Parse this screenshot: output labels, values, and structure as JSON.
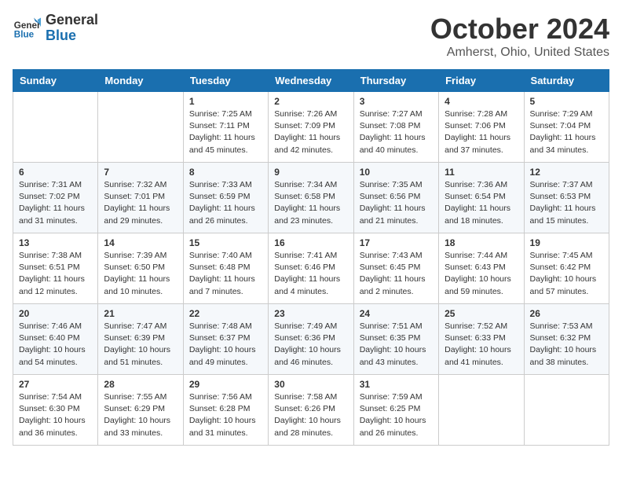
{
  "header": {
    "logo_general": "General",
    "logo_blue": "Blue",
    "month_title": "October 2024",
    "location": "Amherst, Ohio, United States"
  },
  "days_of_week": [
    "Sunday",
    "Monday",
    "Tuesday",
    "Wednesday",
    "Thursday",
    "Friday",
    "Saturday"
  ],
  "weeks": [
    [
      {
        "day": "",
        "info": ""
      },
      {
        "day": "",
        "info": ""
      },
      {
        "day": "1",
        "info": "Sunrise: 7:25 AM\nSunset: 7:11 PM\nDaylight: 11 hours and 45 minutes."
      },
      {
        "day": "2",
        "info": "Sunrise: 7:26 AM\nSunset: 7:09 PM\nDaylight: 11 hours and 42 minutes."
      },
      {
        "day": "3",
        "info": "Sunrise: 7:27 AM\nSunset: 7:08 PM\nDaylight: 11 hours and 40 minutes."
      },
      {
        "day": "4",
        "info": "Sunrise: 7:28 AM\nSunset: 7:06 PM\nDaylight: 11 hours and 37 minutes."
      },
      {
        "day": "5",
        "info": "Sunrise: 7:29 AM\nSunset: 7:04 PM\nDaylight: 11 hours and 34 minutes."
      }
    ],
    [
      {
        "day": "6",
        "info": "Sunrise: 7:31 AM\nSunset: 7:02 PM\nDaylight: 11 hours and 31 minutes."
      },
      {
        "day": "7",
        "info": "Sunrise: 7:32 AM\nSunset: 7:01 PM\nDaylight: 11 hours and 29 minutes."
      },
      {
        "day": "8",
        "info": "Sunrise: 7:33 AM\nSunset: 6:59 PM\nDaylight: 11 hours and 26 minutes."
      },
      {
        "day": "9",
        "info": "Sunrise: 7:34 AM\nSunset: 6:58 PM\nDaylight: 11 hours and 23 minutes."
      },
      {
        "day": "10",
        "info": "Sunrise: 7:35 AM\nSunset: 6:56 PM\nDaylight: 11 hours and 21 minutes."
      },
      {
        "day": "11",
        "info": "Sunrise: 7:36 AM\nSunset: 6:54 PM\nDaylight: 11 hours and 18 minutes."
      },
      {
        "day": "12",
        "info": "Sunrise: 7:37 AM\nSunset: 6:53 PM\nDaylight: 11 hours and 15 minutes."
      }
    ],
    [
      {
        "day": "13",
        "info": "Sunrise: 7:38 AM\nSunset: 6:51 PM\nDaylight: 11 hours and 12 minutes."
      },
      {
        "day": "14",
        "info": "Sunrise: 7:39 AM\nSunset: 6:50 PM\nDaylight: 11 hours and 10 minutes."
      },
      {
        "day": "15",
        "info": "Sunrise: 7:40 AM\nSunset: 6:48 PM\nDaylight: 11 hours and 7 minutes."
      },
      {
        "day": "16",
        "info": "Sunrise: 7:41 AM\nSunset: 6:46 PM\nDaylight: 11 hours and 4 minutes."
      },
      {
        "day": "17",
        "info": "Sunrise: 7:43 AM\nSunset: 6:45 PM\nDaylight: 11 hours and 2 minutes."
      },
      {
        "day": "18",
        "info": "Sunrise: 7:44 AM\nSunset: 6:43 PM\nDaylight: 10 hours and 59 minutes."
      },
      {
        "day": "19",
        "info": "Sunrise: 7:45 AM\nSunset: 6:42 PM\nDaylight: 10 hours and 57 minutes."
      }
    ],
    [
      {
        "day": "20",
        "info": "Sunrise: 7:46 AM\nSunset: 6:40 PM\nDaylight: 10 hours and 54 minutes."
      },
      {
        "day": "21",
        "info": "Sunrise: 7:47 AM\nSunset: 6:39 PM\nDaylight: 10 hours and 51 minutes."
      },
      {
        "day": "22",
        "info": "Sunrise: 7:48 AM\nSunset: 6:37 PM\nDaylight: 10 hours and 49 minutes."
      },
      {
        "day": "23",
        "info": "Sunrise: 7:49 AM\nSunset: 6:36 PM\nDaylight: 10 hours and 46 minutes."
      },
      {
        "day": "24",
        "info": "Sunrise: 7:51 AM\nSunset: 6:35 PM\nDaylight: 10 hours and 43 minutes."
      },
      {
        "day": "25",
        "info": "Sunrise: 7:52 AM\nSunset: 6:33 PM\nDaylight: 10 hours and 41 minutes."
      },
      {
        "day": "26",
        "info": "Sunrise: 7:53 AM\nSunset: 6:32 PM\nDaylight: 10 hours and 38 minutes."
      }
    ],
    [
      {
        "day": "27",
        "info": "Sunrise: 7:54 AM\nSunset: 6:30 PM\nDaylight: 10 hours and 36 minutes."
      },
      {
        "day": "28",
        "info": "Sunrise: 7:55 AM\nSunset: 6:29 PM\nDaylight: 10 hours and 33 minutes."
      },
      {
        "day": "29",
        "info": "Sunrise: 7:56 AM\nSunset: 6:28 PM\nDaylight: 10 hours and 31 minutes."
      },
      {
        "day": "30",
        "info": "Sunrise: 7:58 AM\nSunset: 6:26 PM\nDaylight: 10 hours and 28 minutes."
      },
      {
        "day": "31",
        "info": "Sunrise: 7:59 AM\nSunset: 6:25 PM\nDaylight: 10 hours and 26 minutes."
      },
      {
        "day": "",
        "info": ""
      },
      {
        "day": "",
        "info": ""
      }
    ]
  ]
}
